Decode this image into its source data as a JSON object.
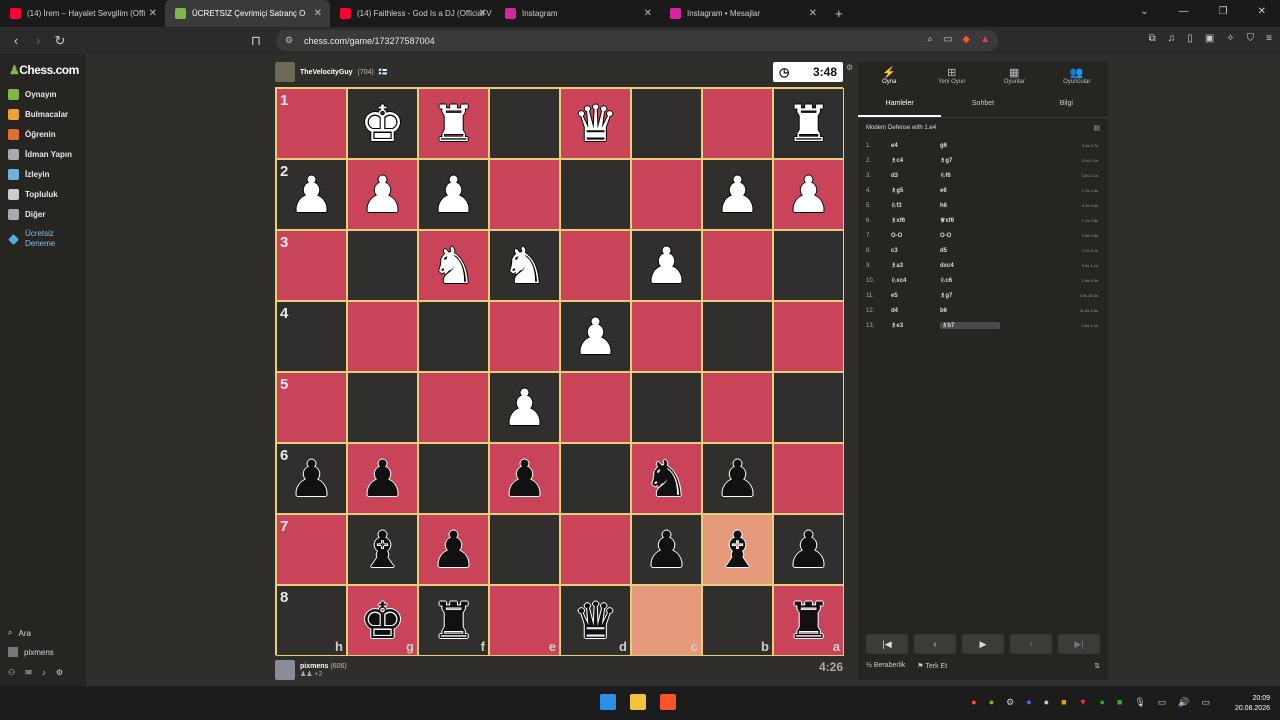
{
  "browser": {
    "tabs": [
      {
        "label": "(14) İrem – Hayalet Sevgilim (Offi",
        "fav": "#ff0033",
        "active": false
      },
      {
        "label": "ÜCRETSİZ Çevrimiçi Satranç O",
        "fav": "#81b64c",
        "active": true
      },
      {
        "label": "(14) Faithless - God Is a DJ (Official V",
        "fav": "#ff0033",
        "active": false
      },
      {
        "label": "Instagram",
        "fav": "#d6249f",
        "active": false
      },
      {
        "label": "Instagram • Mesajlar",
        "fav": "#d6249f",
        "active": false
      }
    ],
    "new_tab": "+",
    "url": "chess.com/game/173277587004"
  },
  "sidebar": {
    "logo": "Chess.com",
    "items": [
      {
        "label": "Oynayın",
        "color": "#81b64c"
      },
      {
        "label": "Bulmacalar",
        "color": "#f0a030"
      },
      {
        "label": "Öğrenin",
        "color": "#e07030"
      },
      {
        "label": "İdman Yapın",
        "color": "#aaaaaa"
      },
      {
        "label": "İzleyin",
        "color": "#6fb0e0"
      },
      {
        "label": "Topluluk",
        "color": "#cccccc"
      },
      {
        "label": "Diğer",
        "color": "#aaaaaa"
      }
    ],
    "trial_line1": "Ücretsiz",
    "trial_line2": "Deneme",
    "search": "Ara",
    "user": "pixmens"
  },
  "game": {
    "top_player": {
      "name": "TheVelocityGuy",
      "rating": "(704)",
      "flag": "🇫🇮"
    },
    "bottom_player": {
      "name": "pixmens",
      "rating": "(606)",
      "captured": "+2"
    },
    "top_clock": "3:48",
    "bottom_clock": "4:26",
    "ranks": [
      "1",
      "2",
      "3",
      "4",
      "5",
      "6",
      "7",
      "8"
    ],
    "files": [
      "h",
      "g",
      "f",
      "e",
      "d",
      "c",
      "b",
      "a"
    ],
    "board": [
      [
        "",
        "wK",
        "wR",
        "",
        "wQ",
        "",
        "",
        "wR"
      ],
      [
        "wP",
        "wP",
        "wP",
        "",
        "",
        "",
        "wP",
        "wP"
      ],
      [
        "",
        "",
        "wN",
        "wN",
        "",
        "wP",
        "",
        ""
      ],
      [
        "",
        "",
        "",
        "",
        "wP",
        "",
        "",
        ""
      ],
      [
        "",
        "",
        "",
        "wP",
        "",
        "",
        "",
        ""
      ],
      [
        "bP",
        "bP",
        "",
        "bP",
        "",
        "bN",
        "bP",
        ""
      ],
      [
        "",
        "bB",
        "bP",
        "",
        "",
        "bP",
        "bB",
        "bP"
      ],
      [
        "",
        "bK",
        "bR",
        "",
        "bQ",
        "",
        "",
        "bR"
      ]
    ]
  },
  "panel": {
    "tabs": [
      {
        "label": "Oyna",
        "icon": "⚡"
      },
      {
        "label": "Yeni Oyun",
        "icon": "⊞"
      },
      {
        "label": "Oyunlar",
        "icon": "▦"
      },
      {
        "label": "Oyuncular",
        "icon": "👥"
      }
    ],
    "subtabs": [
      "Hamleler",
      "Sohbet",
      "Bilgi"
    ],
    "opening": "Modern Defense with 1.e4",
    "moves": [
      {
        "n": "1.",
        "w": "e4",
        "b": "g6",
        "t": "3.3s 0.7s"
      },
      {
        "n": "2.",
        "w": "♗c4",
        "b": "♗g7",
        "t": "1.0s 0.1s"
      },
      {
        "n": "3.",
        "w": "d3",
        "b": "♘f6",
        "t": "3.6s 0.1s"
      },
      {
        "n": "4.",
        "w": "♗g5",
        "b": "e6",
        "t": "1.2s 2.8s"
      },
      {
        "n": "5.",
        "w": "♘f3",
        "b": "h6",
        "t": "4.3s 0.6s"
      },
      {
        "n": "6.",
        "w": "♗xf6",
        "b": "♕xf6",
        "t": "1.2s 0.8s"
      },
      {
        "n": "7.",
        "w": "O-O",
        "b": "O-O",
        "t": "2.9s 0.8s"
      },
      {
        "n": "8.",
        "w": "c3",
        "b": "d5",
        "t": "2.2s 5.2s"
      },
      {
        "n": "9.",
        "w": "♗a3",
        "b": "dxc4",
        "t": "0.4s 1.1s"
      },
      {
        "n": "10.",
        "w": "♘xc4",
        "b": "♘c6",
        "t": "1.5s 6.9s"
      },
      {
        "n": "11.",
        "w": "e5",
        "b": "♗g7",
        "t": "3.9s 10.0s"
      },
      {
        "n": "12.",
        "w": "d4",
        "b": "b6",
        "t": "41.5s 3.6s"
      },
      {
        "n": "13.",
        "w": "♗e3",
        "b": "♗b7",
        "t": "2.6s 1.2s"
      }
    ],
    "draw": "½ Beraberlik",
    "resign": "Terk Et"
  },
  "taskbar": {
    "time": "20:09",
    "date": "20.08.2026"
  }
}
